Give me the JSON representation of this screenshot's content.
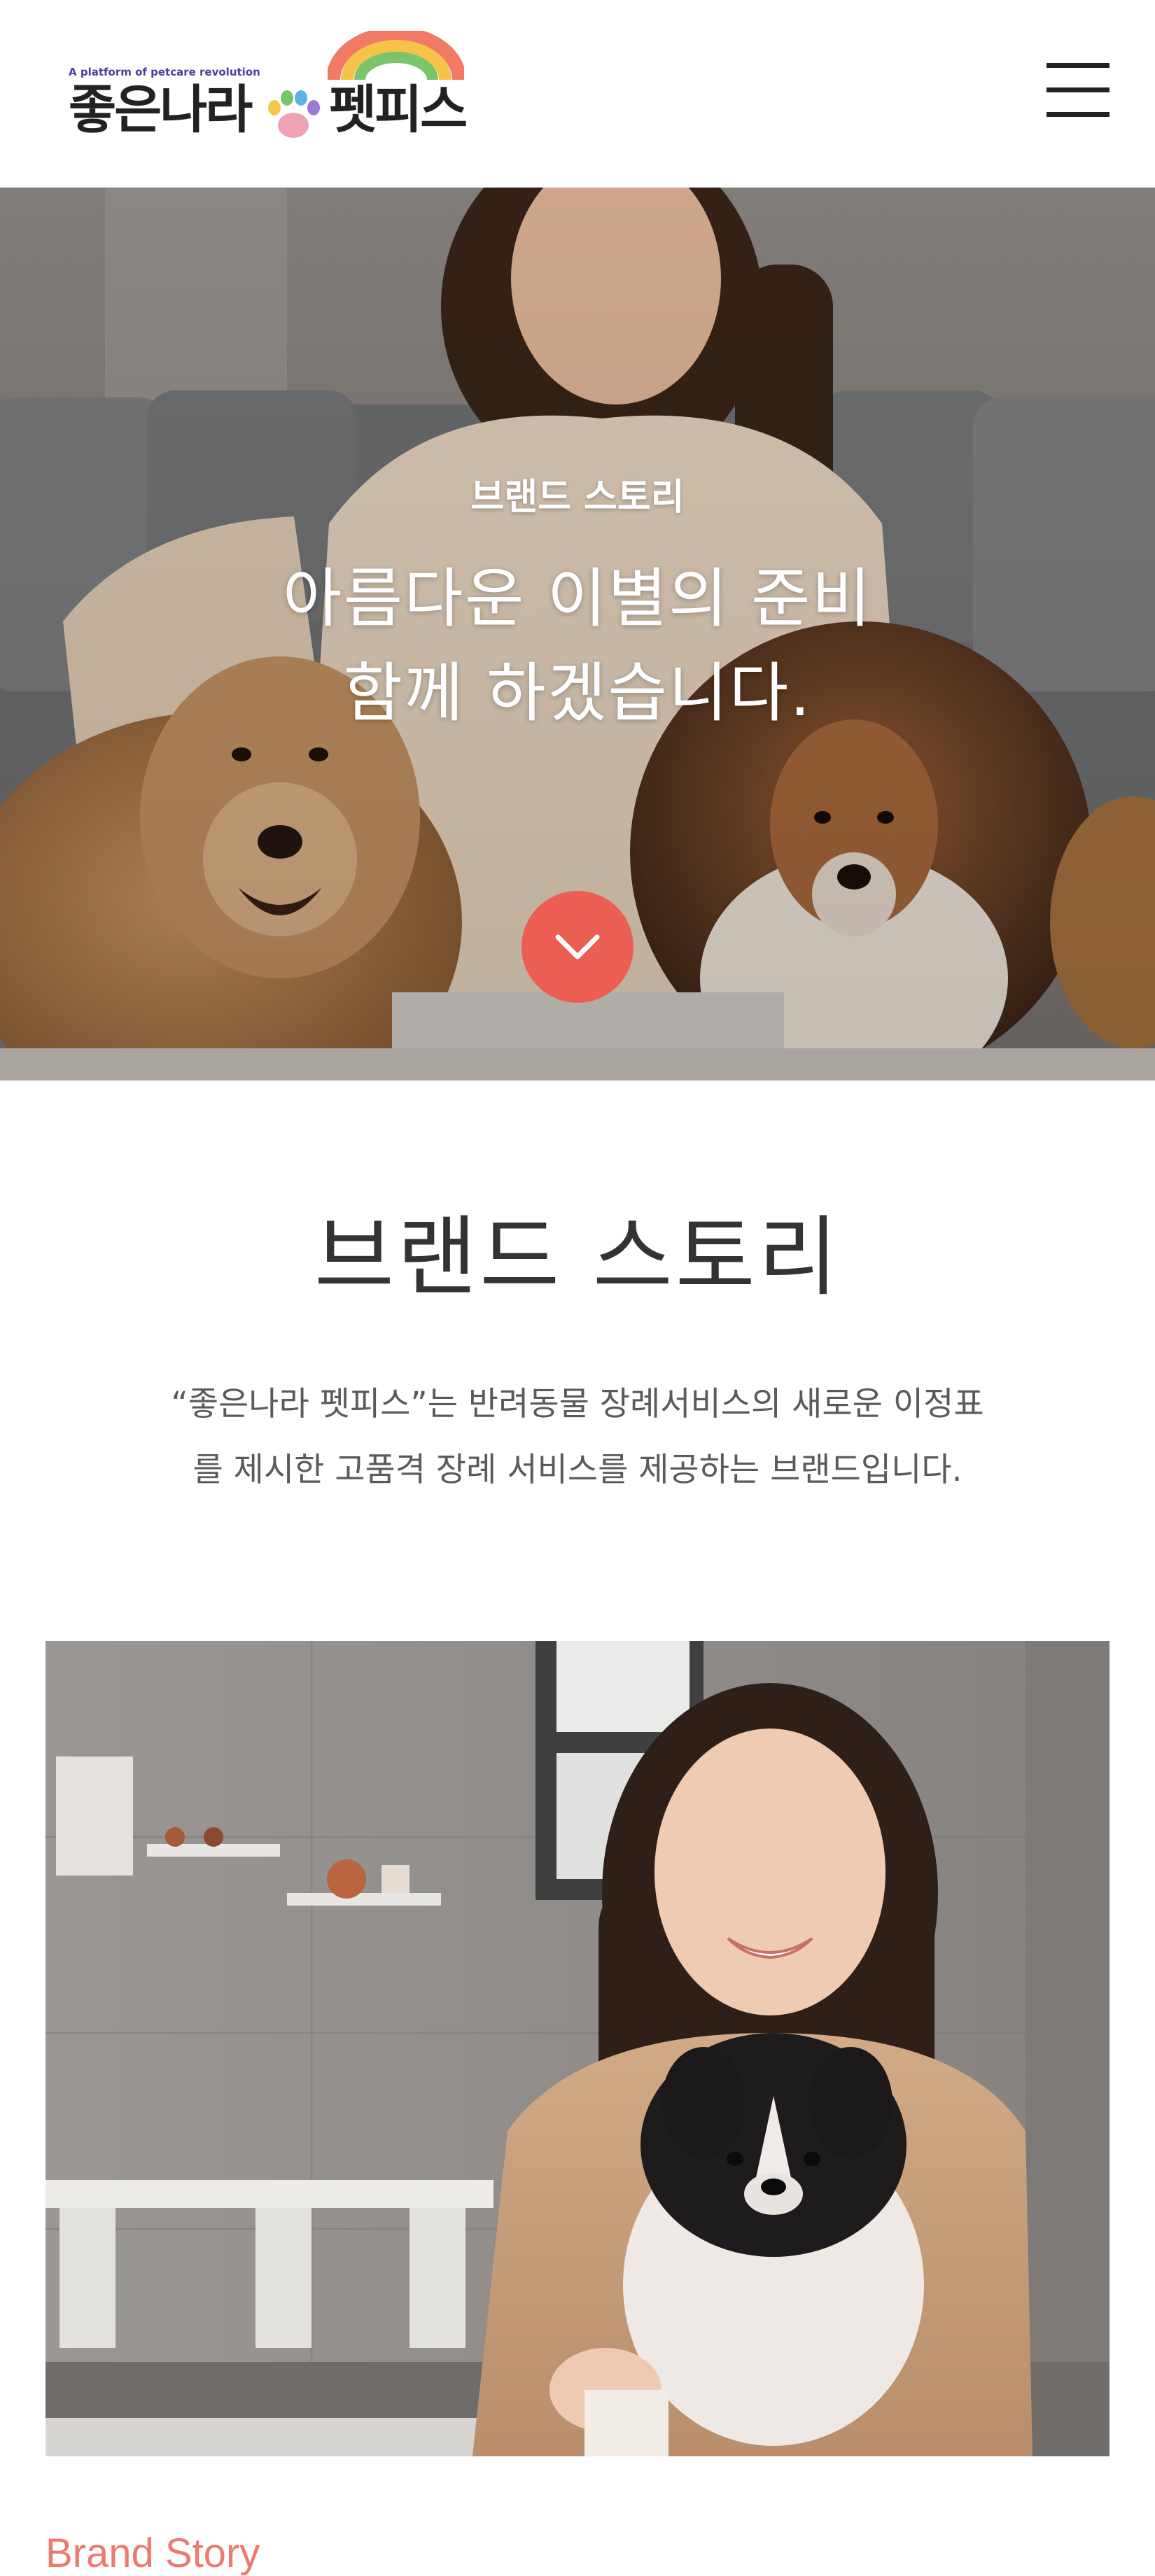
{
  "header": {
    "logo": {
      "tagline": "A platform of petcare revolution",
      "name_left": "좋은나라",
      "name_right": "펫피스"
    },
    "menu_icon": "hamburger-menu-icon"
  },
  "hero": {
    "kicker": "브랜드 스토리",
    "title_lines": [
      "아름다운 이별의 준비",
      "함께 하겠습니다."
    ],
    "scroll_icon": "chevron-down-icon",
    "accent_color": "#ea5f52"
  },
  "brand": {
    "title": "브랜드 스토리",
    "description_lines": [
      "“좋은나라 펫피스”는 반려동물 장례서비스의 새로운 이정표",
      "를 제시한 고품격 장례 서비스를 제공하는 브랜드입니다."
    ],
    "label": "Brand Story",
    "label_color": "#ec7b6f"
  }
}
